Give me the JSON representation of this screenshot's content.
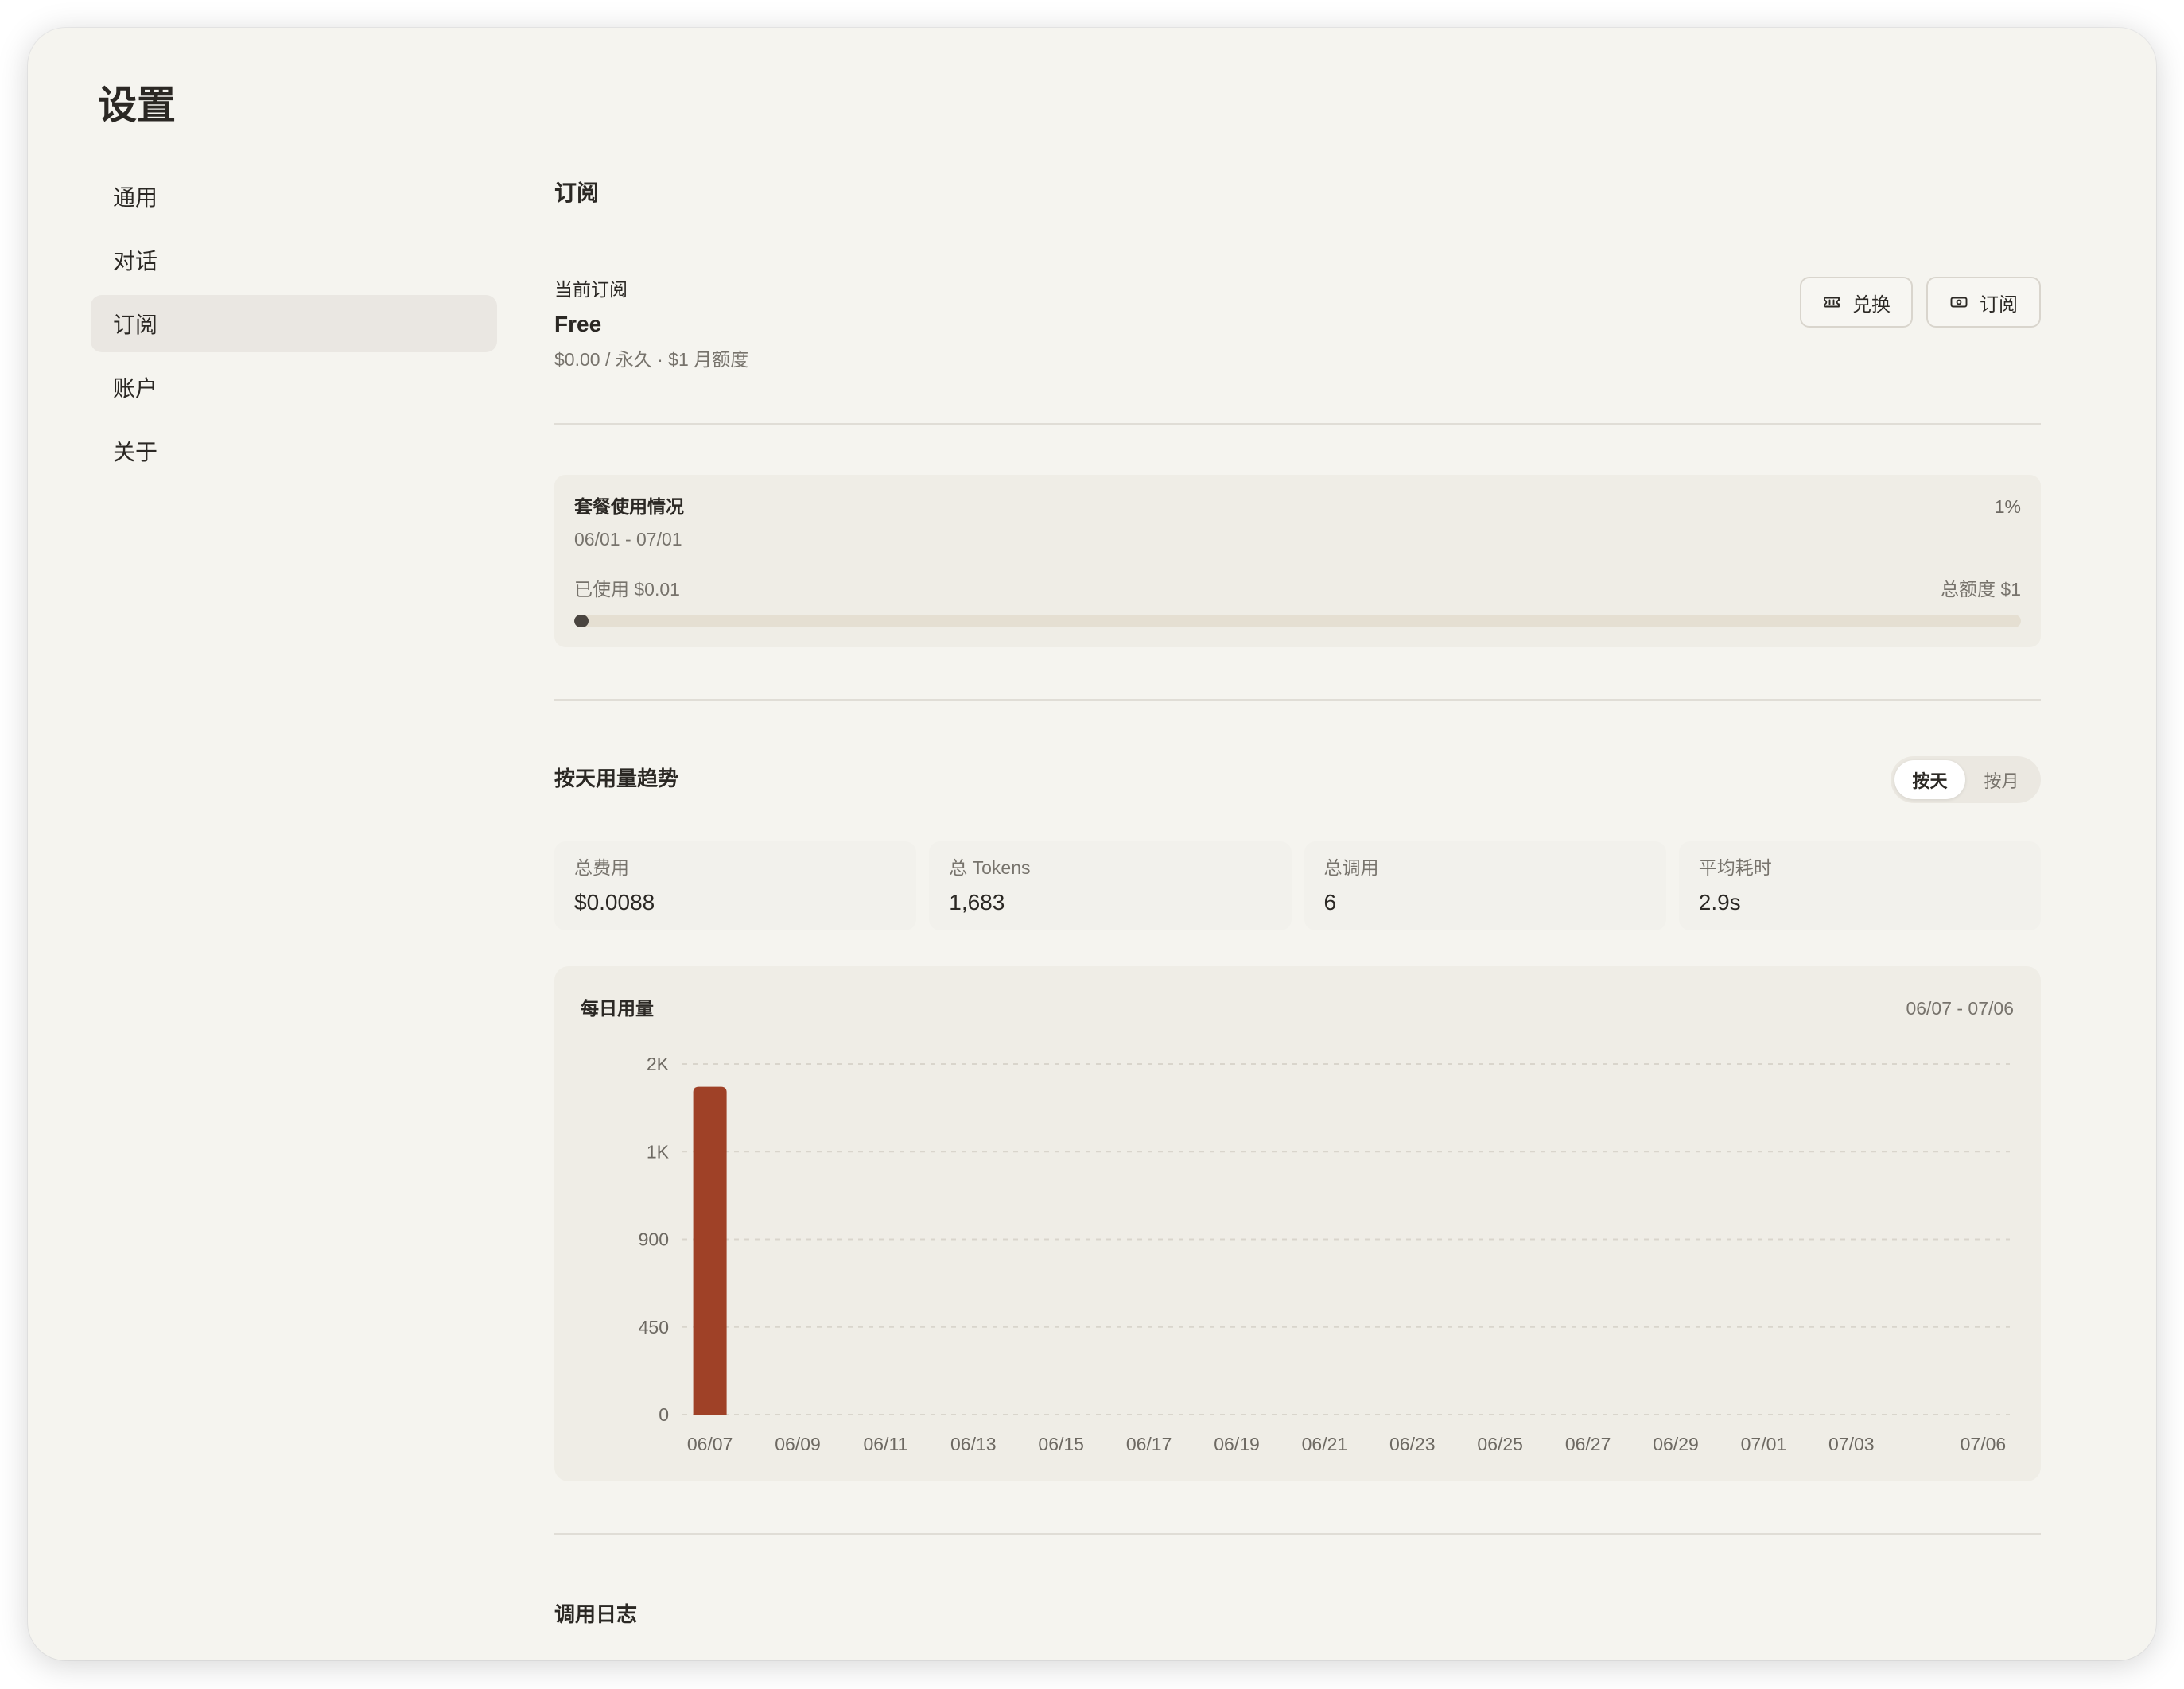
{
  "app": {
    "title": "设置"
  },
  "sidebar": {
    "items": [
      {
        "label": "通用"
      },
      {
        "label": "对话"
      },
      {
        "label": "订阅"
      },
      {
        "label": "账户"
      },
      {
        "label": "关于"
      }
    ]
  },
  "subscription": {
    "section_title": "订阅",
    "current_label": "当前订阅",
    "plan_name": "Free",
    "plan_detail": "$0.00 / 永久 · $1 月额度",
    "buttons": {
      "redeem": {
        "label": "兑换",
        "icon": "ticket-icon"
      },
      "subscribe": {
        "label": "订阅",
        "icon": "banknote-icon"
      }
    }
  },
  "usage": {
    "title": "套餐使用情况",
    "percent_label": "1%",
    "period": "06/01 - 07/01",
    "used_label": "已使用 $0.01",
    "quota_label": "总额度 $1",
    "used_fraction": 0.01
  },
  "trend": {
    "title": "按天用量趋势",
    "toggle": {
      "daily": "按天",
      "monthly": "按月"
    },
    "stats": [
      {
        "label": "总费用",
        "value": "$0.0088"
      },
      {
        "label": "总 Tokens",
        "value": "1,683"
      },
      {
        "label": "总调用",
        "value": "6"
      },
      {
        "label": "平均耗时",
        "value": "2.9s"
      }
    ]
  },
  "chart_data": {
    "type": "bar",
    "title": "每日用量",
    "date_range": "06/07 - 07/06",
    "x_tick_labels": [
      "06/07",
      "06/09",
      "06/11",
      "06/13",
      "06/15",
      "06/17",
      "06/19",
      "06/21",
      "06/23",
      "06/25",
      "06/27",
      "06/29",
      "07/01",
      "07/03",
      "07/06"
    ],
    "series": [
      {
        "values": [
          1683,
          0,
          0,
          0,
          0,
          0,
          0,
          0,
          0,
          0,
          0,
          0,
          0,
          0,
          0,
          0,
          0,
          0,
          0,
          0,
          0,
          0,
          0,
          0,
          0,
          0,
          0,
          0,
          0,
          0
        ]
      }
    ],
    "ylim": [
      0,
      1800
    ],
    "y_ticks": [
      0,
      450,
      900,
      1350,
      1800
    ],
    "y_tick_labels": [
      "0",
      "450",
      "900",
      "1K",
      "2K"
    ],
    "grid": true,
    "color": "#9f4127"
  },
  "log": {
    "title": "调用日志"
  },
  "colors": {
    "window_background": "#f5f4ef",
    "card_background": "#efede6",
    "progress_fill": "#4a4540",
    "bar": "#9f4127"
  }
}
